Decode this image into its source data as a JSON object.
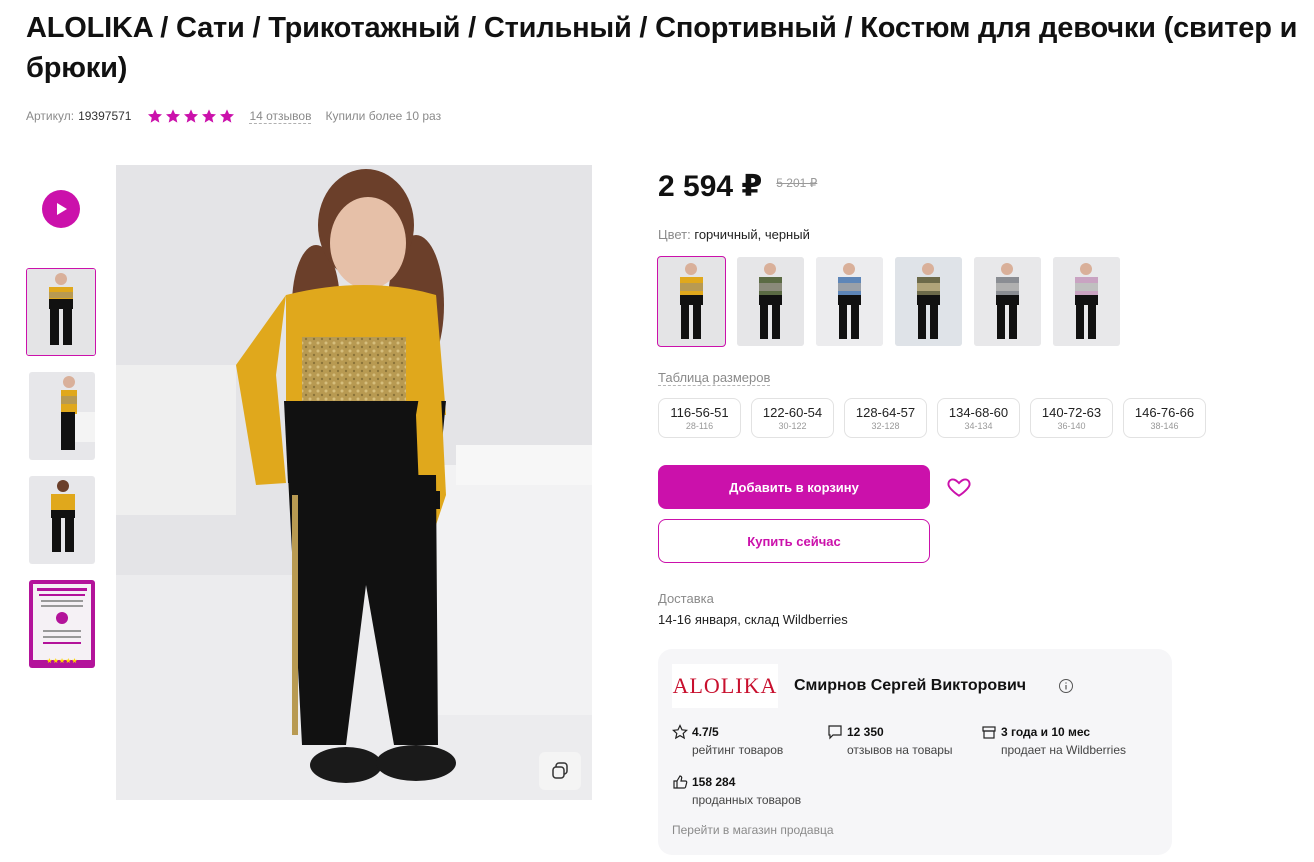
{
  "product": {
    "title": "ALOLIKA / Сати / Трикотажный / Стильный / Спортивный / Костюм для девочки (свитер и брюки)",
    "article_label": "Артикул:",
    "article_value": "19397571",
    "rating_stars": 5,
    "reviews_link": "14 отзывов",
    "bought_text": "Купили более 10 раз"
  },
  "gallery": {
    "video_icon": "play-icon",
    "copy_icon": "copy-icon",
    "thumbnails": [
      "photo-front",
      "photo-side",
      "photo-back",
      "promo-card"
    ],
    "promo_stars": "★★★★★"
  },
  "pricing": {
    "price": "2 594 ₽",
    "old_price": "5 201 ₽"
  },
  "color": {
    "label": "Цвет:",
    "value": "горчичный, черный",
    "options": [
      {
        "name": "горчичный, черный",
        "hex": "#e0a81c"
      },
      {
        "name": "хаки",
        "hex": "#5b6b44"
      },
      {
        "name": "голубой",
        "hex": "#5e86b8"
      },
      {
        "name": "хаки-пайетки",
        "hex": "#6c6a4a"
      },
      {
        "name": "серый",
        "hex": "#8a8d93"
      },
      {
        "name": "розовый",
        "hex": "#c9a3c2"
      }
    ]
  },
  "sizes": {
    "label": "Таблица размеров",
    "items": [
      {
        "size": "116-56-51",
        "ru": "28-116"
      },
      {
        "size": "122-60-54",
        "ru": "30-122"
      },
      {
        "size": "128-64-57",
        "ru": "32-128"
      },
      {
        "size": "134-68-60",
        "ru": "34-134"
      },
      {
        "size": "140-72-63",
        "ru": "36-140"
      },
      {
        "size": "146-76-66",
        "ru": "38-146"
      }
    ]
  },
  "actions": {
    "add_to_cart": "Добавить в корзину",
    "buy_now": "Купить сейчас",
    "favorite_icon": "heart-icon"
  },
  "delivery": {
    "label": "Доставка",
    "value": "14-16 января, склад Wildberries"
  },
  "seller": {
    "logo_text": "ALOLIKA",
    "name": "Смирнов Сергей Викторович",
    "stats": [
      {
        "icon": "star-outline-icon",
        "value": "4.7/5",
        "label": "рейтинг товаров"
      },
      {
        "icon": "comment-icon",
        "value": "12 350",
        "label": "отзывов на товары"
      },
      {
        "icon": "shop-icon",
        "value": "3 года и 10 мес",
        "label": "продает на Wildberries"
      },
      {
        "icon": "thumbs-up-icon",
        "value": "158 284",
        "label": "проданных товаров"
      }
    ],
    "link": "Перейти в магазин продавца"
  },
  "colors": {
    "accent": "#cb11ab",
    "logo": "#c8102e"
  }
}
